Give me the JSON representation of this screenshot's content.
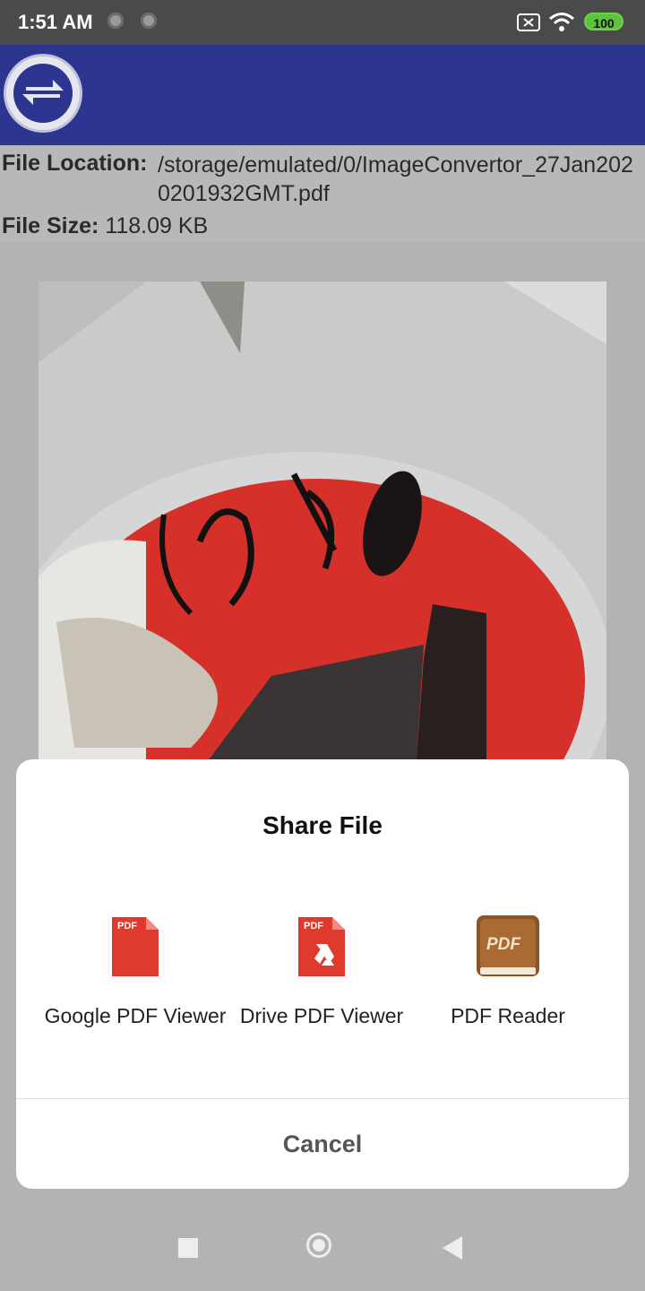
{
  "status_bar": {
    "time": "1:51 AM",
    "battery": "100"
  },
  "file_info": {
    "location_label": "File Location:",
    "location_value": "/storage/emulated/0/ImageConvertor_27Jan2020201932GMT.pdf",
    "size_label": "File Size:",
    "size_value": "118.09 KB"
  },
  "share_dialog": {
    "title": "Share File",
    "apps": [
      {
        "name": "Google PDF Viewer",
        "icon": "pdf-file-icon"
      },
      {
        "name": "Drive PDF Viewer",
        "icon": "drive-pdf-icon"
      },
      {
        "name": "PDF Reader",
        "icon": "pdf-book-icon"
      }
    ],
    "icon_badge_pdf": "PDF",
    "cancel_label": "Cancel"
  },
  "colors": {
    "app_bar": "#2c3590",
    "scrim": "#b3b3b3",
    "pdf_red": "#e03a2f",
    "battery_green": "#5cc43a"
  }
}
